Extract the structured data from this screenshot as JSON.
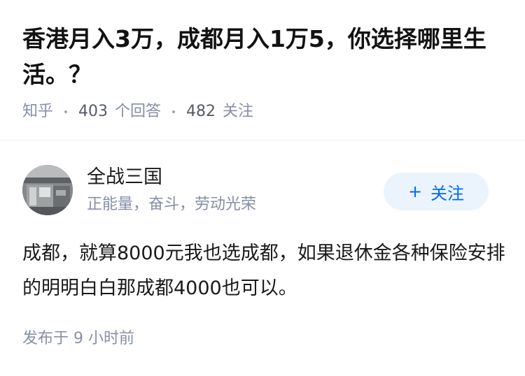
{
  "question": {
    "title": "香港月入3万，成都月入1万5，你选择哪里生活。？",
    "source": "知乎",
    "answers_count": "403",
    "answers_label": "个回答",
    "followers_count": "482",
    "followers_label": "关注"
  },
  "answer": {
    "author": {
      "name": "全战三国",
      "bio": "正能量，奋斗，劳动光荣"
    },
    "follow_button": {
      "icon": "plus-icon",
      "label": "关注"
    },
    "content": "成都，就算8000元我也选成都，如果退休金各种保险安排的明明白白那成都4000也可以。",
    "time_prefix": "发布于",
    "time_value": "9 小时前"
  },
  "colors": {
    "title": "#121212",
    "meta_gray": "#8590a6",
    "accent_blue": "#0066ff",
    "follow_bg": "#ebf4fd",
    "divider": "#eeeeee"
  }
}
